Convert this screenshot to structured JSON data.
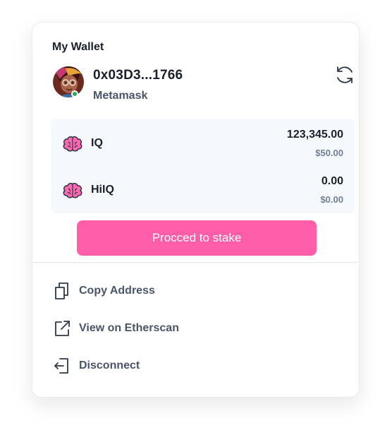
{
  "wallet": {
    "title": "My Wallet",
    "address": "0x03D3...1766",
    "provider": "Metamask",
    "status_color": "#38a169"
  },
  "tokens": [
    {
      "symbol": "IQ",
      "amount": "123,345.00",
      "usd": "$50.00",
      "icon": "brain-icon"
    },
    {
      "symbol": "HiIQ",
      "amount": "0.00",
      "usd": "$0.00",
      "icon": "brain-icon"
    }
  ],
  "actions": {
    "stake_label": "Procced to stake",
    "stake_color": "#ff5caa"
  },
  "menu": [
    {
      "label": "Copy Address",
      "icon": "copy-icon"
    },
    {
      "label": "View on Etherscan",
      "icon": "external-link-icon"
    },
    {
      "label": "Disconnect",
      "icon": "logout-icon"
    }
  ],
  "icons": {
    "refresh": "refresh-icon",
    "avatar": "avatar"
  }
}
